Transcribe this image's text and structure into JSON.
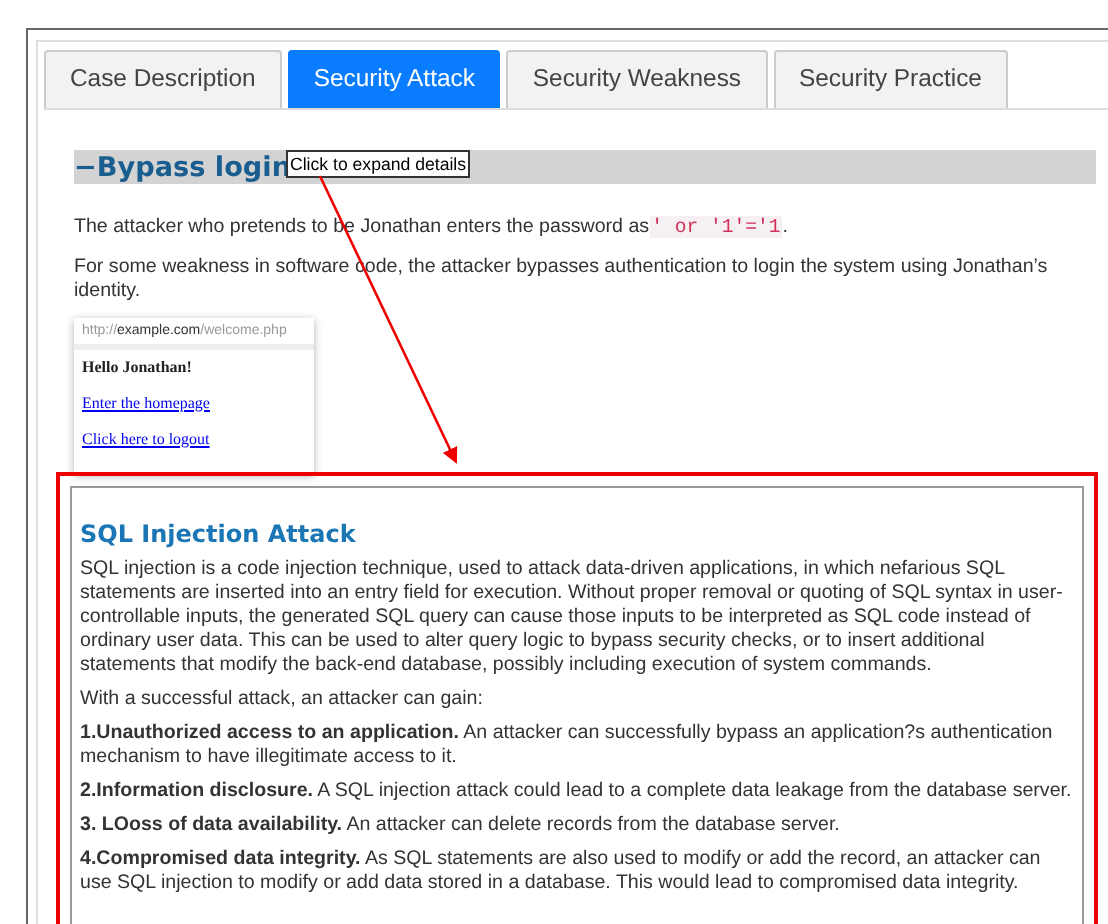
{
  "tabs": [
    {
      "label": "Case Description",
      "selected": false
    },
    {
      "label": "Security Attack",
      "selected": true
    },
    {
      "label": "Security Weakness",
      "selected": false
    },
    {
      "label": "Security Practice",
      "selected": false
    }
  ],
  "section": {
    "toggle": "−",
    "title": "Bypass login",
    "expanded": true,
    "tooltip": "Click to expand details"
  },
  "intro": {
    "before": "The attacker who pretends to be Jonathan enters the password as",
    "code": "' or '1'='1",
    "after": "."
  },
  "summary": "For some weakness in software code, the attacker bypasses authentication to login the system using Jonathan’s identity.",
  "browser_mockup": {
    "url_prefix": "http://",
    "url_host": "example.com",
    "url_path": "/welcome.php",
    "greeting": "Hello Jonathan!",
    "links": [
      "Enter the homepage",
      "Click here to logout"
    ]
  },
  "details": {
    "title": "SQL Injection Attack",
    "paragraph": "SQL injection is a code injection technique, used to attack data-driven applications, in which nefarious SQL statements are inserted into an entry field for execution. Without proper removal or quoting of SQL syntax in user-controllable inputs, the generated SQL query can cause those inputs to be interpreted as SQL code instead of ordinary user data. This can be used to alter query logic to bypass security checks, or to insert additional statements that modify the back-end database, possibly including execution of system commands.",
    "lead": "With a successful attack, an attacker can gain:",
    "items": [
      "**1.Unauthorized access to an application.** An attacker can successfully bypass an application?s authentication mechanism to have illegitimate access to it.",
      "**2.Information disclosure.** A SQL injection attack could lead to a complete data leakage from the database server.",
      "**3. LOoss of data availability.** An attacker can delete records from the database server.",
      "**4.Compromised data integrity.** As SQL statements are also used to modify or add the record, an attacker can use SQL injection to modify or add data stored in a database. This would lead to compromised data integrity."
    ]
  }
}
